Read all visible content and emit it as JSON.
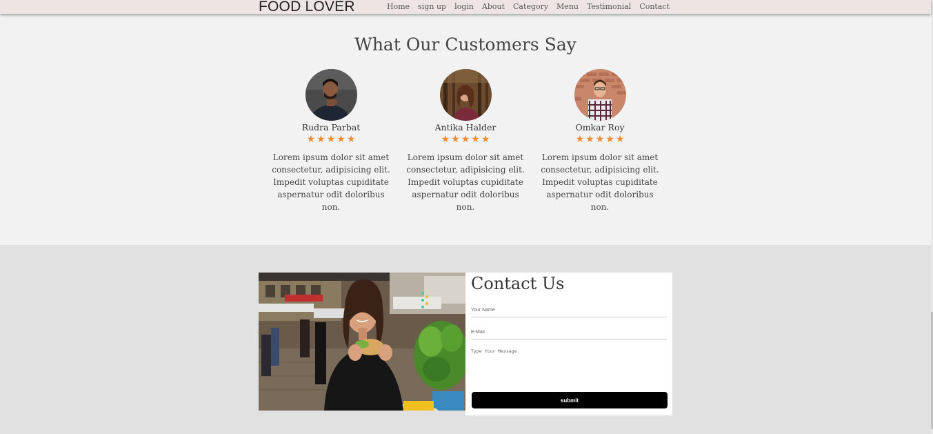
{
  "header": {
    "logo": "FOOD LOVER",
    "nav": [
      "Home",
      "sign up",
      "login",
      "About",
      "Category",
      "Menu",
      "Testimonial",
      "Contact"
    ]
  },
  "testimonials": {
    "title": "What Our Customers Say",
    "rating_star": "★",
    "items": [
      {
        "name": "Rudra Parbat",
        "rating": 5,
        "text": "Lorem ipsum dolor sit amet consectetur, adipisicing elit. Impedit voluptas cupiditate aspernatur odit doloribus non."
      },
      {
        "name": "Antika Halder",
        "rating": 5,
        "text": "Lorem ipsum dolor sit amet consectetur, adipisicing elit. Impedit voluptas cupiditate aspernatur odit doloribus non."
      },
      {
        "name": "Omkar Roy",
        "rating": 5,
        "text": "Lorem ipsum dolor sit amet consectetur, adipisicing elit. Impedit voluptas cupiditate aspernatur odit doloribus non."
      }
    ]
  },
  "contact": {
    "title": "Contact Us",
    "name_placeholder": "Your Name",
    "email_placeholder": "E-Mail",
    "message_placeholder": "Type Your Message",
    "submit_label": "submit"
  },
  "colors": {
    "header_bg": "#efe4e4",
    "star": "#f28b30",
    "submit_bg": "#000000",
    "contact_section_bg": "#e1e1e1"
  }
}
